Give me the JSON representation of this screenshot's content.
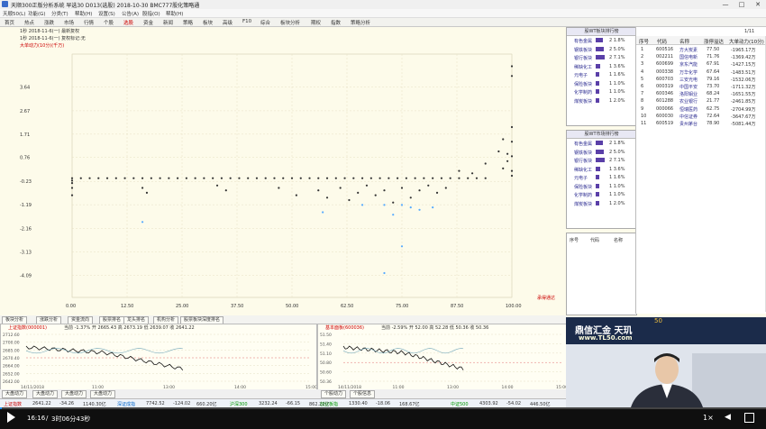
{
  "window": {
    "title": "天顺300正版分析系统 早选30 D013(选股) 2018-10-30 BMC777股化策略通",
    "buttons": [
      "—",
      "□",
      "✕"
    ]
  },
  "menu": [
    "天顺50(L)",
    "功能(G)",
    "分类(T)",
    "帮助(H)",
    "设置(S)",
    "公告(A)",
    "股指(O)",
    "帮助(H)"
  ],
  "toolbar": {
    "items": [
      "首页",
      "热点",
      "涨跌",
      "市场",
      "行情",
      "个股",
      "选股",
      "资金",
      "新闻",
      "策略",
      "板块",
      "高级",
      "F10",
      "综合",
      "板块分析",
      "期权",
      "指数",
      "策略分析"
    ],
    "active_index": 6
  },
  "chart_header": {
    "line1": "1秒  2018-11-6(一)  最新复权",
    "line2": "1秒  2018-11-6(一)  复权标记:无",
    "axis_title": "大单动力(10分)(千万)",
    "corner_note": "承得通达",
    "y_ticks": [
      "3.64",
      "2.67",
      "1.71",
      "0.76",
      "-0.23",
      "-1.19",
      "-2.16",
      "-3.13",
      "-4.09"
    ],
    "x_ticks": [
      "0.00",
      "12.50",
      "25.00",
      "37.50",
      "50.00",
      "62.50",
      "75.00",
      "87.50",
      "100.00"
    ]
  },
  "chart_data": {
    "type": "scatter",
    "title": "",
    "xlabel": "",
    "ylabel": "大单动力(10分)(千万)",
    "xlim": [
      0,
      100
    ],
    "ylim": [
      -5,
      5
    ],
    "series": [
      {
        "color": "#333333",
        "x": [
          0,
          0,
          0,
          0,
          0,
          2,
          4,
          6,
          8,
          10,
          12,
          14,
          16,
          18,
          20,
          22,
          24,
          26,
          28,
          30,
          32,
          34,
          36,
          38,
          40,
          42,
          44,
          46,
          48,
          50,
          52,
          54,
          56,
          58,
          60,
          62,
          64,
          66,
          68,
          70,
          72,
          74,
          76,
          78,
          80,
          82,
          84,
          86,
          88,
          90,
          92,
          94,
          16,
          17,
          33,
          35,
          47,
          51,
          56,
          58,
          61,
          63,
          65,
          67,
          69,
          71,
          73,
          75,
          77,
          79,
          81,
          83,
          85,
          88,
          91,
          94,
          97,
          98,
          98,
          99,
          99,
          100,
          100,
          100,
          100,
          100,
          100,
          100
        ],
        "y": [
          -0.2,
          -0.1,
          -0.3,
          -0.5,
          -0.8,
          -0.1,
          -0.1,
          -0.1,
          -0.1,
          -0.1,
          -0.1,
          -0.1,
          -0.1,
          -0.1,
          -0.1,
          -0.1,
          -0.1,
          -0.1,
          -0.1,
          -0.1,
          -0.1,
          -0.1,
          -0.1,
          -0.1,
          -0.1,
          -0.1,
          -0.1,
          -0.1,
          -0.1,
          -0.1,
          -0.1,
          -0.1,
          -0.1,
          -0.1,
          -0.1,
          -0.1,
          -0.1,
          -0.1,
          -0.1,
          -0.1,
          -0.1,
          -0.1,
          -0.1,
          -0.1,
          -0.1,
          -0.1,
          -0.1,
          -0.1,
          -0.1,
          -0.1,
          -0.1,
          -0.1,
          -0.5,
          -0.7,
          -0.4,
          -0.6,
          -0.5,
          -0.8,
          -0.6,
          -0.9,
          -0.5,
          -1.0,
          -0.7,
          -0.4,
          -0.8,
          -0.6,
          -1.1,
          -0.5,
          -0.9,
          -0.6,
          -0.4,
          -0.7,
          -0.5,
          0.2,
          0.1,
          0.5,
          1.0,
          1.5,
          0.3,
          0.6,
          0.9,
          0.0,
          4.5,
          4.1,
          2.0,
          1.4,
          0.8,
          0.2
        ]
      },
      {
        "color": "#55aaff",
        "x": [
          16,
          57,
          66,
          71,
          73,
          75,
          77,
          79,
          82,
          71,
          75
        ],
        "y": [
          -1.9,
          -1.5,
          -1.2,
          -1.2,
          -1.6,
          -1.2,
          -1.3,
          -1.4,
          -1.3,
          -4.0,
          -2.9
        ],
        "name": ""
      }
    ]
  },
  "panels": [
    {
      "title": "股WT板块排行榜",
      "rows": [
        {
          "name": "有色金属",
          "count": "2",
          "pct": "1.8%",
          "fill": 0.7
        },
        {
          "name": "钢铁板块",
          "count": "2",
          "pct": "5.0%",
          "fill": 0.75
        },
        {
          "name": "银行板块",
          "count": "2",
          "pct": "7.1%",
          "fill": 0.8
        },
        {
          "name": "稀缺化工",
          "count": "1",
          "pct": "3.6%",
          "fill": 0.4
        },
        {
          "name": "元电子",
          "count": "1",
          "pct": "1.6%",
          "fill": 0.3
        },
        {
          "name": "保险板块",
          "count": "1",
          "pct": "1.0%",
          "fill": 0.3
        },
        {
          "name": "化学制药",
          "count": "1",
          "pct": "1.0%",
          "fill": 0.3
        },
        {
          "name": "煤炭板块",
          "count": "1",
          "pct": "2.0%",
          "fill": 0.3
        }
      ]
    },
    {
      "title": "股WT市场排行榜",
      "rows": [
        {
          "name": "有色金属",
          "count": "2",
          "pct": "1.8%",
          "fill": 0.7
        },
        {
          "name": "钢铁板块",
          "count": "2",
          "pct": "5.0%",
          "fill": 0.75
        },
        {
          "name": "银行板块",
          "count": "2",
          "pct": "7.1%",
          "fill": 0.8
        },
        {
          "name": "稀缺化工",
          "count": "1",
          "pct": "3.6%",
          "fill": 0.4
        },
        {
          "name": "元电子",
          "count": "1",
          "pct": "1.6%",
          "fill": 0.3
        },
        {
          "name": "保险板块",
          "count": "1",
          "pct": "1.0%",
          "fill": 0.3
        },
        {
          "name": "化学制药",
          "count": "1",
          "pct": "1.0%",
          "fill": 0.3
        },
        {
          "name": "煤炭板块",
          "count": "1",
          "pct": "2.0%",
          "fill": 0.3
        }
      ]
    }
  ],
  "low_panel": {
    "cols": [
      "序号",
      "代码",
      "名称"
    ]
  },
  "table": {
    "page": "1/11",
    "cols": [
      "序号",
      "代码",
      "名称",
      "涨停溢达",
      "大单动力(10分)"
    ],
    "rows": [
      [
        "1",
        "600516",
        "方大炭素",
        "77.50",
        "-1965.17万"
      ],
      [
        "2",
        "002211",
        "国信电新",
        "71.76",
        "-1369.42万"
      ],
      [
        "3",
        "600699",
        "京东汽能",
        "67.91",
        "-1427.15万"
      ],
      [
        "4",
        "000338",
        "万华化学",
        "67.64",
        "-1483.51万"
      ],
      [
        "5",
        "600703",
        "三安光电",
        "79.16",
        "-1532.06万"
      ],
      [
        "6",
        "000319",
        "中国平安",
        "73.70",
        "-1711.32万"
      ],
      [
        "7",
        "600346",
        "洛阳钼业",
        "68.24",
        "-1651.55万"
      ],
      [
        "8",
        "601288",
        "农业银行",
        "21.77",
        "-2461.85万"
      ],
      [
        "9",
        "000066",
        "恒瑞医药",
        "62.75",
        "-2704.99万"
      ],
      [
        "10",
        "600030",
        "中信证券",
        "72.64",
        "-3647.67万"
      ],
      [
        "11",
        "600519",
        "贵州茅台",
        "78.90",
        "-5081.44万"
      ]
    ]
  },
  "bottom_tabs": [
    "板块分析",
    "涨跌分析",
    "资金流向",
    "股票排名",
    "龙头排名",
    "机构分析",
    "股票板块深度排名"
  ],
  "mini_charts": [
    {
      "title": "上证指数(000001)",
      "stats": "当前 -1.37%  开 2665.43  高 2673.19  低 2639.07  收 2641.22",
      "y_ticks": [
        "2712.60",
        "2700.00",
        "2685.00",
        "2670.40",
        "2664.00",
        "2652.00",
        "2642.00"
      ],
      "x_ticks": [
        "14/11/2018",
        "11:00",
        "13:00",
        "14:00",
        "15:00"
      ],
      "close": "2641.22"
    },
    {
      "title": "基本面板(600036)",
      "stats": "当前 -2.59%  开 52.00  高 52.28  低 50.36  收 50.36",
      "y_ticks": [
        "51.50",
        "51.40",
        "51.10",
        "50.80",
        "50.60",
        "50.36"
      ],
      "x_ticks": [
        "14/11/2018",
        "11:00",
        "13:00",
        "14:00",
        "15:00"
      ],
      "close": "50.36"
    }
  ],
  "bottom_tabs2": [
    "大盘动力",
    "大盘动力",
    "大盘动力",
    "大盘动力",
    "个股动力",
    "个股信息"
  ],
  "quote_bar": [
    {
      "label": "上证指数",
      "value": "2641.22",
      "chg": "-34.26",
      "v": "1140.30亿",
      "color": "#cc0000"
    },
    {
      "label": "深证成指",
      "value": "7742.52",
      "chg": "-124.02",
      "v": "660.20亿",
      "color": "#0066cc"
    },
    {
      "label": "沪深300",
      "value": "3232.24",
      "chg": "-66.15",
      "v": "862.22亿",
      "color": "#009900"
    },
    {
      "label": "创业板指",
      "value": "1330.40",
      "chg": "-18.06",
      "v": "168.67亿",
      "color": "#009900"
    },
    {
      "label": "中证500",
      "value": "4303.92",
      "chg": "-54.02",
      "v": "446.50亿",
      "color": "#009900"
    }
  ],
  "video": {
    "logo": "鼎信汇金 天玑",
    "url": "www.TL50.com",
    "badge": "50"
  },
  "player": {
    "time": "16:16",
    "remaining": "3时06分43秒",
    "speed": "1×",
    "play_icon": "play-icon"
  },
  "colors": {
    "accent": "#5a3fa8",
    "up": "#cc0000",
    "down": "#009900",
    "grid": "#e0ddc8"
  }
}
